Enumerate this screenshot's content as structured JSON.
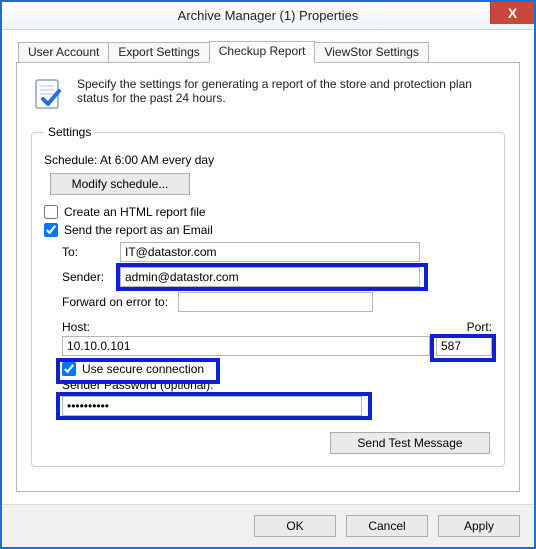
{
  "window": {
    "title": "Archive Manager (1) Properties",
    "close_label": "X"
  },
  "tabs": {
    "user_account": "User Account",
    "export_settings": "Export Settings",
    "checkup_report": "Checkup Report",
    "viewstor_settings": "ViewStor Settings"
  },
  "intro": "Specify the settings for generating a report of the store and protection plan status for the past 24 hours.",
  "settings": {
    "legend": "Settings",
    "schedule_line": "Schedule: At 6:00 AM every day",
    "modify_schedule": "Modify schedule...",
    "create_html": "Create an HTML report file",
    "send_email": "Send the report as an Email",
    "to_label": "To:",
    "to_value": "IT@datastor.com",
    "sender_label": "Sender:",
    "sender_value": "admin@datastor.com",
    "forward_label": "Forward on error to:",
    "forward_value": "",
    "host_label": "Host:",
    "host_value": "10.10.0.101",
    "port_label": "Port:",
    "port_value": "587",
    "secure_label": "Use secure connection",
    "pw_label": "Sender Password (optional):",
    "pw_value": "••••••••••",
    "send_test": "Send Test Message"
  },
  "buttons": {
    "ok": "OK",
    "cancel": "Cancel",
    "apply": "Apply"
  }
}
